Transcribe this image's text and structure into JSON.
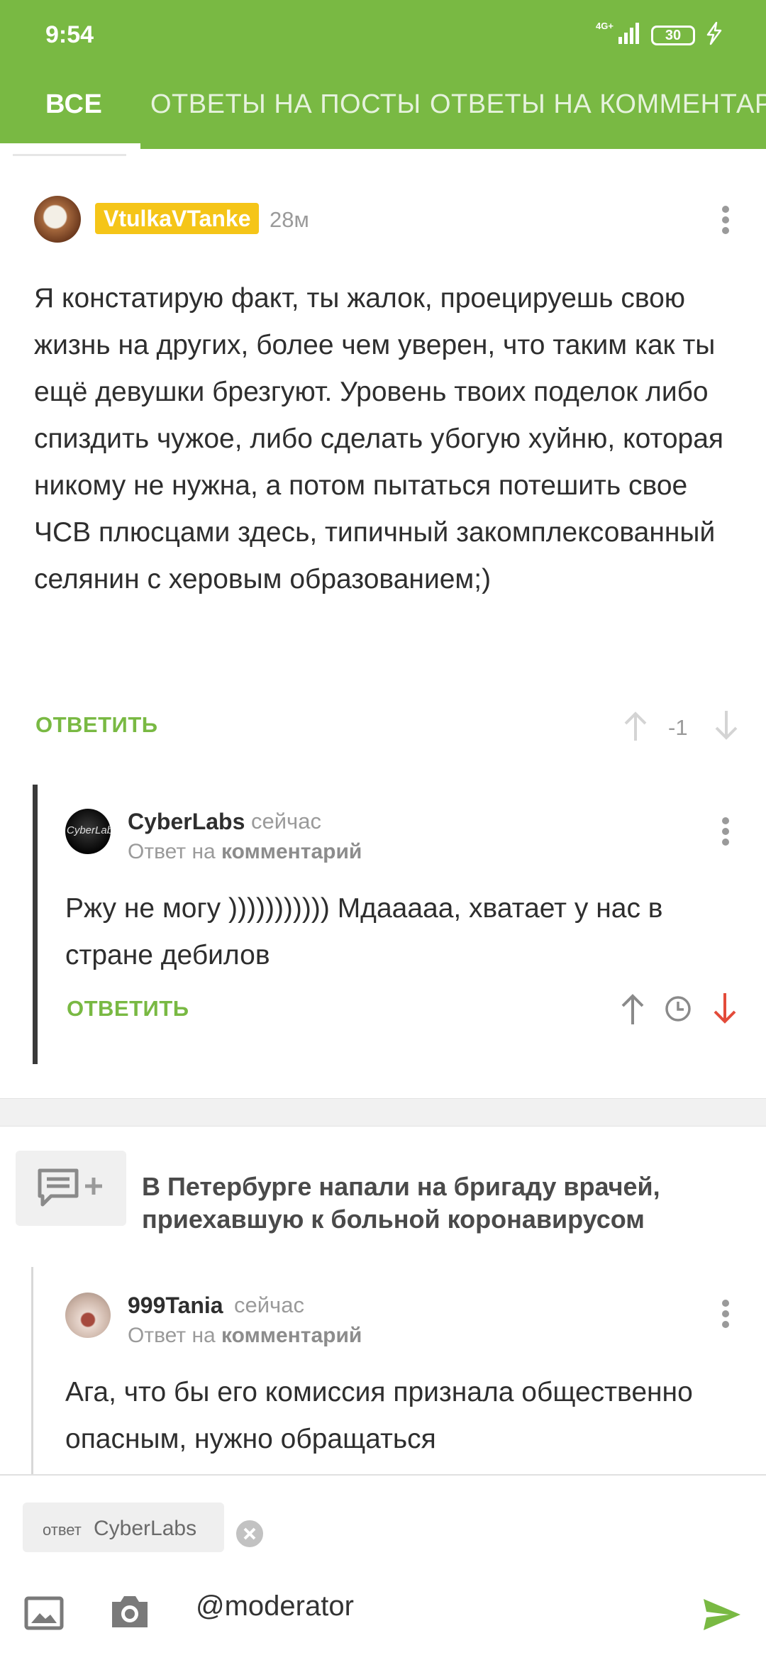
{
  "status_bar": {
    "time": "9:54",
    "network": "4G+",
    "battery": "30"
  },
  "tabs": [
    {
      "label": "ВСЕ",
      "active": true
    },
    {
      "label": "ОТВЕТЫ НА ПОСТЫ",
      "active": false
    },
    {
      "label": "ОТВЕТЫ НА КОММЕНТАРИИ",
      "active": false
    }
  ],
  "comment1": {
    "author": "VtulkaVTanke",
    "time": "28м",
    "text": "Я констатирую факт, ты жалок, проецируешь свою жизнь на других, более чем уверен, что таким как ты ещё девушки брезгуют. Уровень твоих поделок либо спиздить чужое, либо сделать убогую хуйню, которая никому не нужна, а потом пытаться потешить свое ЧСВ плюсцами здесь, типичный закомплексованный селянин с херовым образованием;)",
    "reply_label": "ОТВЕТИТЬ",
    "rating": "-1"
  },
  "comment2": {
    "author": "CyberLabs",
    "avatar_text": "CyberLabs",
    "time": "сейчас",
    "reply_prefix": "Ответ на",
    "reply_target": "комментарий",
    "text": "Ржу не могу ))))))))))) Мдааааа, хватает у нас в стране дебилов",
    "reply_label": "ОТВЕТИТЬ"
  },
  "post": {
    "title": "В Петербурге напали на бригаду врачей, приехавшую к больной коронавирусом"
  },
  "comment3": {
    "author": "999Tania",
    "time": "сейчас",
    "reply_prefix": "Ответ на",
    "reply_target": "комментарий",
    "text": "Ага, что бы его комиссия признала общественно опасным, нужно обращаться"
  },
  "composer": {
    "chip_label": "ответ",
    "chip_name": "CyberLabs",
    "input_value": "@moderator"
  },
  "colors": {
    "accent": "#79b943",
    "badge": "#f5c518",
    "downvote_active": "#e34b3a"
  }
}
